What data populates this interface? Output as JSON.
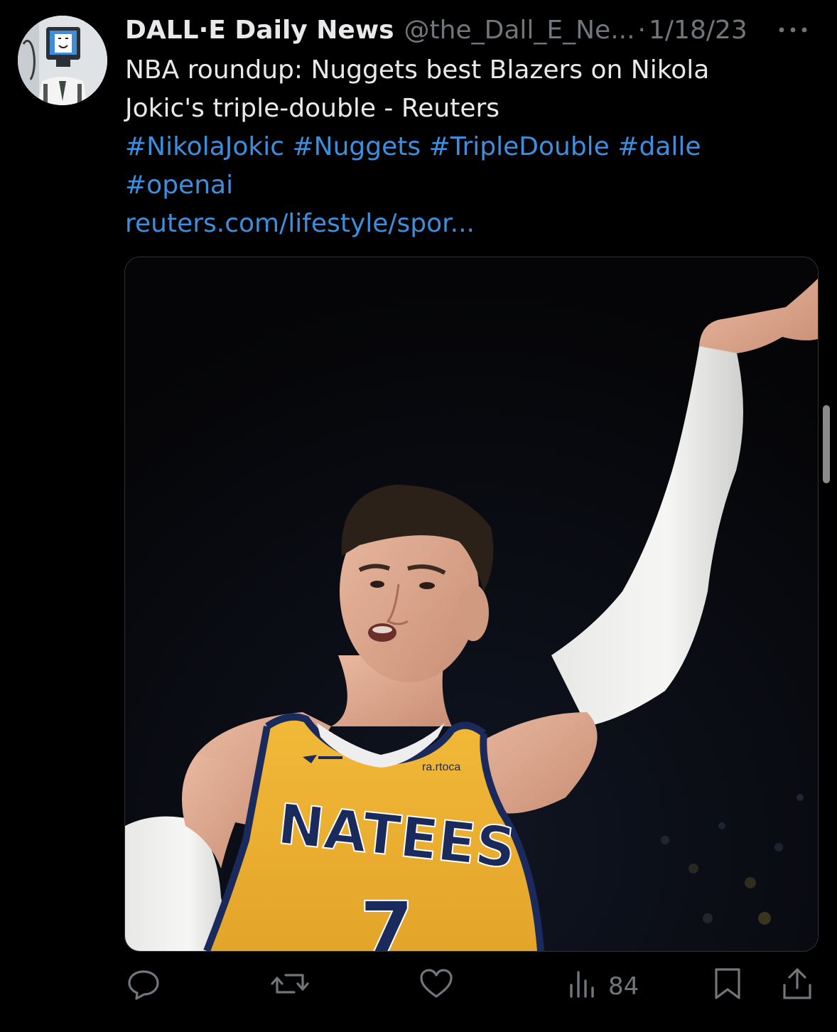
{
  "tweet": {
    "display_name": "DALL·E Daily News",
    "handle": "@the_Dall_E_Ne...",
    "separator": "·",
    "date": "1/18/23",
    "text_line1": "NBA roundup: Nuggets best Blazers on Nikola",
    "text_line2": "Jokic's triple-double - Reuters",
    "hashtags_line1": [
      "#NikolaJokic",
      "#Nuggets",
      "#TripleDouble",
      "#dalle"
    ],
    "hashtags_line2": [
      "#openai"
    ],
    "link": "reuters.com/lifestyle/spor..."
  },
  "media": {
    "jersey_team": "NATEES",
    "jersey_number": "7",
    "jersey_small_text": "ra.rtoca"
  },
  "actions": {
    "views_count": "84"
  },
  "colors": {
    "background": "#000000",
    "text": "#e7e9ea",
    "muted": "#71767b",
    "link": "#3e8ede",
    "jersey": "#f0b232",
    "jersey_trim": "#1b2a5c"
  },
  "icons": [
    "more-icon",
    "reply-icon",
    "retweet-icon",
    "like-icon",
    "views-icon",
    "bookmark-icon",
    "share-icon"
  ]
}
